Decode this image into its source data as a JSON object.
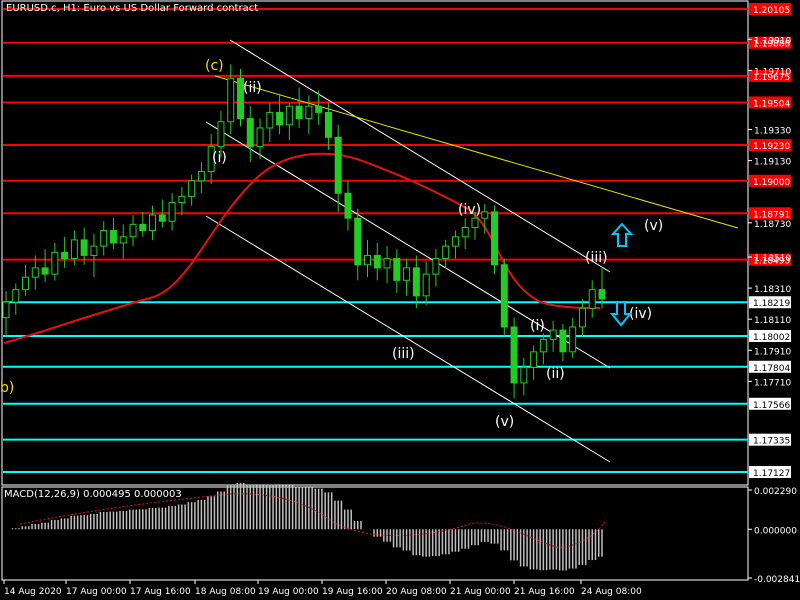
{
  "window": {
    "title": "EURUSD.c, H1:  Euro vs US Dollar Forward contract",
    "macd_title": "MACD(12,26,9) 0.000495 0.000003"
  },
  "colors": {
    "background": "#000000",
    "candle": "#22cc22",
    "grid": "#ffffff",
    "resistance": "#ff0000",
    "support": "#00ffff",
    "ma": "#e81010",
    "trendline": "#ffffff",
    "upper_trendline": "#e8e000",
    "wave_label": "#ffffff",
    "wave_label_c": "#f0e000",
    "arrow": "#00c8ff",
    "macd_hist": "#c0c0c0",
    "macd_signal": "#e81010"
  },
  "chart_data": [
    {
      "type": "candlestick",
      "symbol": "EURUSD.c",
      "timeframe": "H1",
      "ylim": [
        1.1705,
        1.2015
      ],
      "y_ticks": [
        "1.18730",
        "1.18510",
        "1.18310",
        "1.18110",
        "1.17910",
        "1.17710",
        "1.19130",
        "1.19330",
        "1.19710",
        "1.19910"
      ],
      "x_ticks": [
        "14 Aug 2020",
        "17 Aug 00:00",
        "17 Aug 16:00",
        "18 Aug 08:00",
        "19 Aug 00:00",
        "19 Aug 16:00",
        "20 Aug 08:00",
        "21 Aug 00:00",
        "21 Aug 16:00",
        "24 Aug 08:00"
      ],
      "resistance_levels": [
        "1.20105",
        "1.19888",
        "1.19675",
        "1.19504",
        "1.19230",
        "1.19000",
        "1.18791",
        "1.18493"
      ],
      "support_levels": [
        "1.18219",
        "1.18002",
        "1.17804",
        "1.17566",
        "1.17335",
        "1.17127"
      ],
      "current_price": "1.18219",
      "ohlc": [
        [
          1.1812,
          1.1829,
          1.18,
          1.1822
        ],
        [
          1.1822,
          1.1834,
          1.1814,
          1.183
        ],
        [
          1.183,
          1.1846,
          1.1826,
          1.1838
        ],
        [
          1.1838,
          1.1852,
          1.183,
          1.1844
        ],
        [
          1.1844,
          1.1856,
          1.1835,
          1.184
        ],
        [
          1.184,
          1.186,
          1.1836,
          1.1854
        ],
        [
          1.1854,
          1.1864,
          1.1844,
          1.185
        ],
        [
          1.185,
          1.1868,
          1.1846,
          1.1862
        ],
        [
          1.1862,
          1.187,
          1.1846,
          1.1852
        ],
        [
          1.1852,
          1.1866,
          1.1838,
          1.1858
        ],
        [
          1.1858,
          1.1874,
          1.1852,
          1.1868
        ],
        [
          1.1868,
          1.1876,
          1.1856,
          1.186
        ],
        [
          1.186,
          1.1872,
          1.185,
          1.1864
        ],
        [
          1.1864,
          1.1878,
          1.1858,
          1.1872
        ],
        [
          1.1872,
          1.188,
          1.1864,
          1.1868
        ],
        [
          1.1868,
          1.1884,
          1.1862,
          1.1878
        ],
        [
          1.1878,
          1.1888,
          1.187,
          1.1874
        ],
        [
          1.1874,
          1.1892,
          1.1868,
          1.1886
        ],
        [
          1.1886,
          1.1896,
          1.1878,
          1.189
        ],
        [
          1.189,
          1.1904,
          1.1884,
          1.19
        ],
        [
          1.19,
          1.1912,
          1.1892,
          1.1906
        ],
        [
          1.1906,
          1.193,
          1.1898,
          1.1922
        ],
        [
          1.1922,
          1.1945,
          1.1915,
          1.1938
        ],
        [
          1.1938,
          1.1975,
          1.193,
          1.1966
        ],
        [
          1.1966,
          1.1972,
          1.1935,
          1.194
        ],
        [
          1.194,
          1.1948,
          1.1912,
          1.1922
        ],
        [
          1.1922,
          1.194,
          1.1914,
          1.1934
        ],
        [
          1.1934,
          1.195,
          1.1925,
          1.1944
        ],
        [
          1.1944,
          1.1956,
          1.193,
          1.1936
        ],
        [
          1.1936,
          1.195,
          1.1926,
          1.1948
        ],
        [
          1.1948,
          1.196,
          1.1934,
          1.194
        ],
        [
          1.194,
          1.1955,
          1.193,
          1.1948
        ],
        [
          1.1948,
          1.1958,
          1.1936,
          1.1944
        ],
        [
          1.1944,
          1.195,
          1.192,
          1.1928
        ],
        [
          1.1928,
          1.1936,
          1.188,
          1.1892
        ],
        [
          1.1892,
          1.19,
          1.1868,
          1.1876
        ],
        [
          1.1876,
          1.1882,
          1.1836,
          1.1846
        ],
        [
          1.1846,
          1.1862,
          1.1838,
          1.1852
        ],
        [
          1.1852,
          1.186,
          1.1836,
          1.1844
        ],
        [
          1.1844,
          1.1858,
          1.1834,
          1.185
        ],
        [
          1.185,
          1.1856,
          1.1828,
          1.1836
        ],
        [
          1.1836,
          1.185,
          1.1826,
          1.1844
        ],
        [
          1.1844,
          1.1852,
          1.1818,
          1.1826
        ],
        [
          1.1826,
          1.1848,
          1.182,
          1.184
        ],
        [
          1.184,
          1.1856,
          1.1832,
          1.185
        ],
        [
          1.185,
          1.1862,
          1.1844,
          1.1858
        ],
        [
          1.1858,
          1.1868,
          1.185,
          1.1864
        ],
        [
          1.1864,
          1.1876,
          1.1856,
          1.187
        ],
        [
          1.187,
          1.188,
          1.1862,
          1.1876
        ],
        [
          1.1876,
          1.1885,
          1.1866,
          1.188
        ],
        [
          1.188,
          1.1884,
          1.184,
          1.1846
        ],
        [
          1.1846,
          1.185,
          1.18,
          1.1806
        ],
        [
          1.1806,
          1.1812,
          1.176,
          1.177
        ],
        [
          1.177,
          1.1786,
          1.1762,
          1.178
        ],
        [
          1.178,
          1.1794,
          1.1772,
          1.179
        ],
        [
          1.179,
          1.1802,
          1.1782,
          1.1798
        ],
        [
          1.1798,
          1.181,
          1.179,
          1.1804
        ],
        [
          1.1804,
          1.1808,
          1.1784,
          1.179
        ],
        [
          1.179,
          1.1812,
          1.1786,
          1.1806
        ],
        [
          1.1806,
          1.1824,
          1.18,
          1.1818
        ],
        [
          1.1818,
          1.1836,
          1.1812,
          1.183
        ],
        [
          1.183,
          1.1845,
          1.1818,
          1.1824
        ]
      ]
    },
    {
      "type": "macd",
      "name": "MACD(12,26,9)",
      "ylim": [
        -0.002841,
        0.00229
      ],
      "y_ticks": [
        "0.002290",
        "0.000000",
        "-0.002841"
      ]
    }
  ],
  "wave_labels": {
    "b": "b)",
    "c": "(c)",
    "i_top": "(i)",
    "ii_top": "(ii)",
    "iii": "(iii)",
    "iv": "(iv)",
    "v": "(v)",
    "i_low": "(i)",
    "ii_low": "(ii)",
    "iii_right": "(iii)",
    "iv_right": "(iv)",
    "v_right": "(v)"
  }
}
